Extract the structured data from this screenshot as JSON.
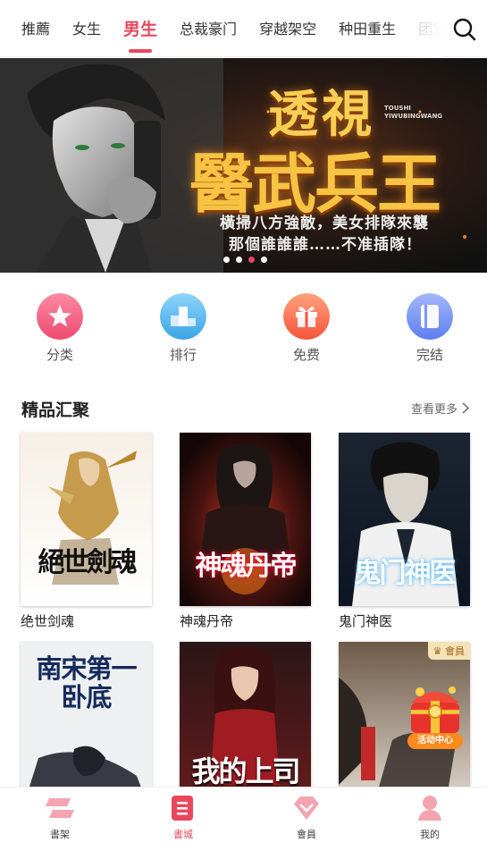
{
  "tabs": [
    {
      "label": "推薦",
      "active": false
    },
    {
      "label": "女生",
      "active": false
    },
    {
      "label": "男生",
      "active": true
    },
    {
      "label": "总裁豪门",
      "active": false
    },
    {
      "label": "穿越架空",
      "active": false
    },
    {
      "label": "种田重生",
      "active": false
    },
    {
      "label": "团宠",
      "active": false
    }
  ],
  "search_icon": "search-icon",
  "banner": {
    "title_top": "透視",
    "title_main": "醫武兵王",
    "pinyin_line1": "TOUSHI",
    "pinyin_line2": "YIWUBINGWANG",
    "tagline1": "橫掃八方強敵，美女排隊來襲",
    "tagline2": "那個誰誰誰……不准插隊！",
    "slide_count": 4,
    "active_slide": 3
  },
  "categories": [
    {
      "label": "分类",
      "icon": "star-icon",
      "color": "#f25c7f"
    },
    {
      "label": "排行",
      "icon": "podium-icon",
      "color": "#4bb3ea"
    },
    {
      "label": "免费",
      "icon": "gift-icon",
      "color": "#fb6b4c"
    },
    {
      "label": "完结",
      "icon": "book-icon",
      "color": "#6d8ff2"
    }
  ],
  "section": {
    "title": "精品汇聚",
    "more_label": "查看更多"
  },
  "books": [
    {
      "name": "绝世剑魂",
      "cover_text": "絕世劍魂"
    },
    {
      "name": "神魂丹帝",
      "cover_text": "神魂丹帝"
    },
    {
      "name": "鬼门神医",
      "cover_text": "鬼门神医"
    },
    {
      "name": "",
      "cover_text": "南宋第一卧底"
    },
    {
      "name": "",
      "cover_text": "我的上司"
    },
    {
      "name": "",
      "cover_text": "",
      "badge": "會員"
    }
  ],
  "activity": {
    "label": "活动中心"
  },
  "bottom_nav": [
    {
      "label": "書架",
      "icon": "bookshelf-icon",
      "active": false
    },
    {
      "label": "書城",
      "icon": "bookstore-icon",
      "active": true
    },
    {
      "label": "會員",
      "icon": "diamond-icon",
      "active": false
    },
    {
      "label": "我的",
      "icon": "profile-icon",
      "active": false
    }
  ],
  "colors": {
    "accent": "#e9475d",
    "gold": "#f6c342"
  }
}
